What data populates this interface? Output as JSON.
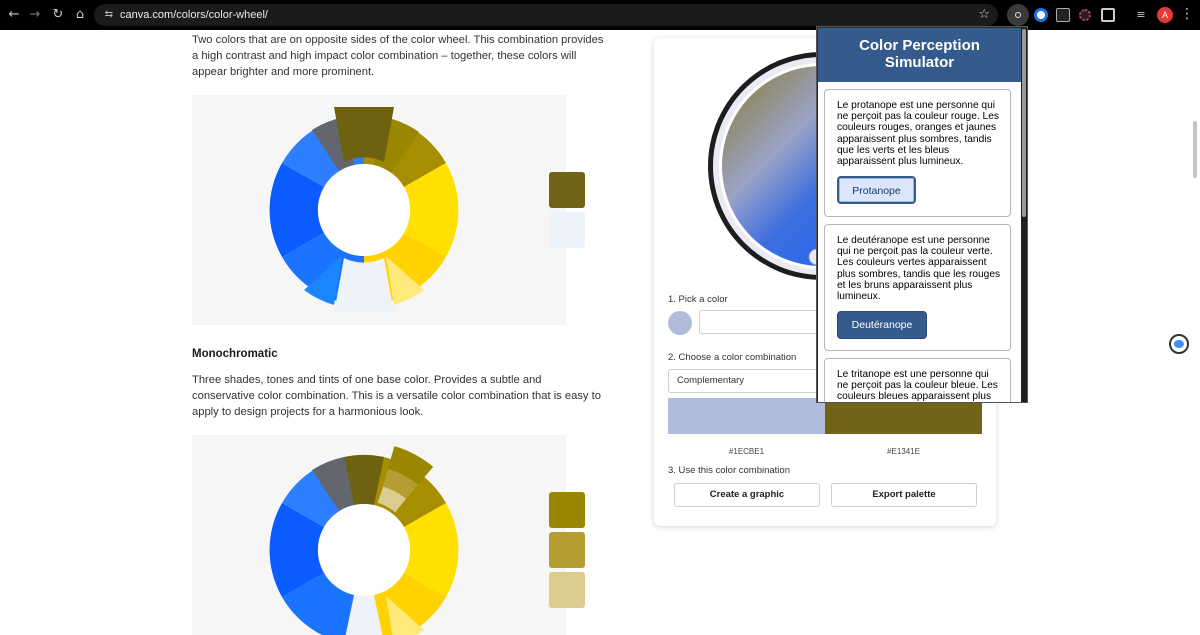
{
  "browser": {
    "url_host": "canva.com",
    "url_path": "/colors/color-wheel/",
    "profile_initial": "A"
  },
  "article": {
    "complementary_text": "Two colors that are on opposite sides of the color wheel. This combination provides a high contrast and high impact color combination – together, these colors will appear brighter and more prominent.",
    "mono_heading": "Monochromatic",
    "mono_text": "Three shades, tones and tints of one base color. Provides a subtle and conservative color combination. This is a versatile color combination that is easy to apply to design projects for a harmonious look.",
    "complementary_swatches": [
      "#716418",
      "#eef2fa"
    ],
    "mono_swatches": [
      "#9c8600",
      "#b69d33",
      "#dccb8e"
    ]
  },
  "tool": {
    "step1": "1. Pick a color",
    "step2": "2. Choose a color combination",
    "combination": "Complementary",
    "hex_left": "#1ECBE1",
    "hex_right": "#E1341E",
    "step3": "3. Use this color combination",
    "create_button": "Create a graphic",
    "export_button": "Export palette"
  },
  "popup": {
    "title_line1": "Color Perception",
    "title_line2": "Simulator",
    "cards": [
      {
        "text": "Le protanope est une personne qui ne perçoit pas la couleur rouge. Les couleurs rouges, oranges et jaunes apparaissent plus sombres, tandis que les verts et les bleus apparaissent plus lumineux.",
        "button": "Protanope",
        "selected": true
      },
      {
        "text": "Le deutéranope est une personne qui ne perçoit pas la couleur verte. Les couleurs vertes apparaissent plus sombres, tandis que les rouges et les bruns apparaissent plus lumineux.",
        "button": "Deutéranope",
        "selected": false
      },
      {
        "text": "Le tritanope est une personne qui ne perçoit pas la couleur bleue. Les couleurs bleues apparaissent plus",
        "button": "",
        "selected": false
      }
    ]
  },
  "colors": {
    "popup_header": "#355b8c",
    "toolbar": "#000000"
  }
}
